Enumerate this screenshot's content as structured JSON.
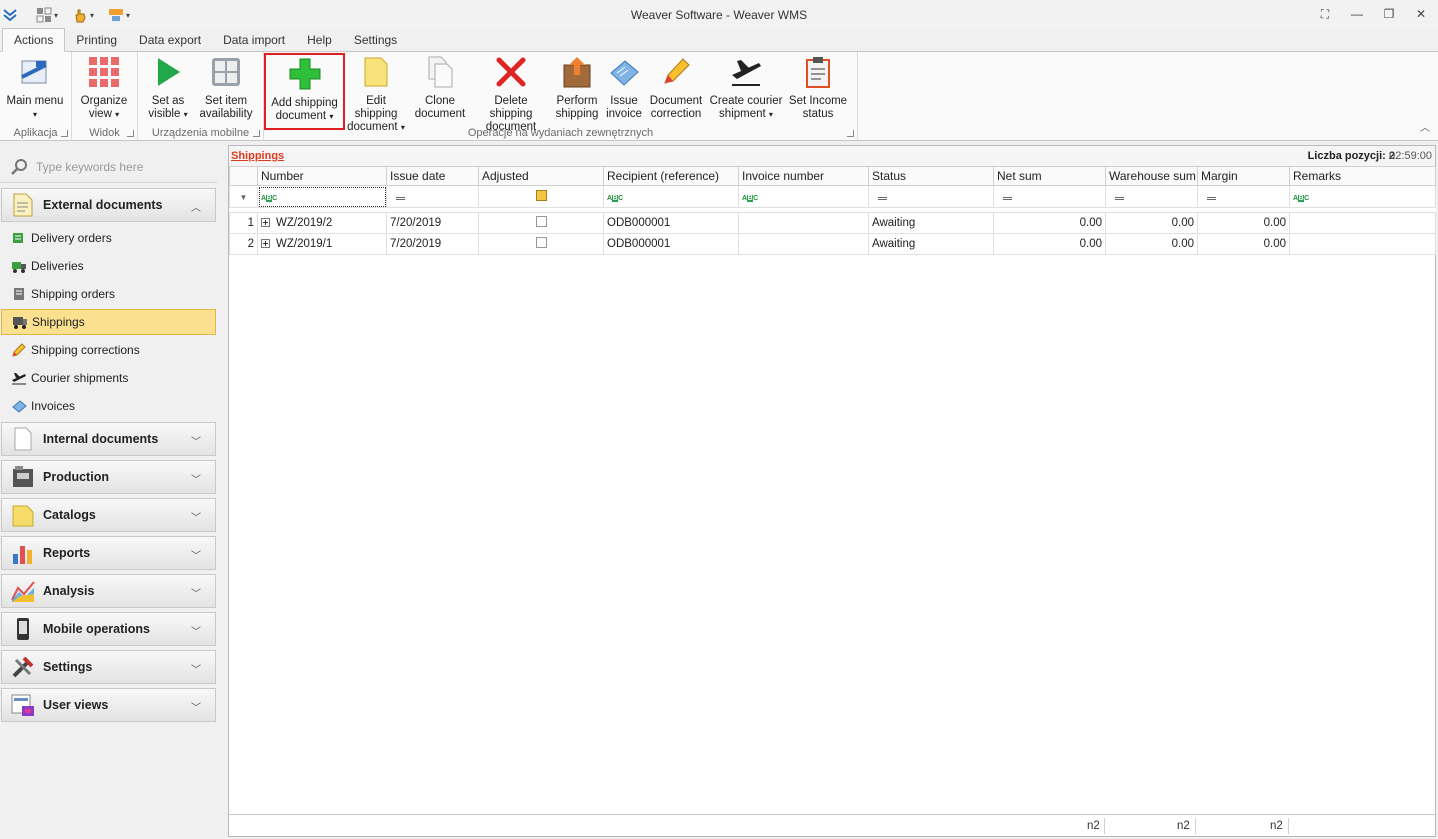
{
  "window": {
    "title": "Weaver Software - Weaver WMS"
  },
  "tabs": [
    {
      "label": "Actions",
      "active": true
    },
    {
      "label": "Printing"
    },
    {
      "label": "Data export"
    },
    {
      "label": "Data import"
    },
    {
      "label": "Help"
    },
    {
      "label": "Settings"
    }
  ],
  "ribbon": {
    "groups": {
      "aplikacja": "Aplikacja",
      "widok": "Widok",
      "urzadzenia": "Urządzenia mobilne",
      "operacje": "Operacje na wydaniach zewnętrznych"
    },
    "buttons": {
      "main_menu": {
        "l1": "Main menu",
        "l2": ""
      },
      "organize_view": {
        "l1": "Organize",
        "l2": "view"
      },
      "set_visible": {
        "l1": "Set as",
        "l2": "visible"
      },
      "set_availability": {
        "l1": "Set item",
        "l2": "availability"
      },
      "add_shipping": {
        "l1": "Add shipping",
        "l2": "document"
      },
      "edit_shipping": {
        "l1": "Edit shipping",
        "l2": "document"
      },
      "clone": {
        "l1": "Clone",
        "l2": "document"
      },
      "delete_shipping": {
        "l1": "Delete shipping",
        "l2": "document"
      },
      "perform_shipping": {
        "l1": "Perform",
        "l2": "shipping"
      },
      "issue_invoice": {
        "l1": "Issue",
        "l2": "invoice"
      },
      "document_correction": {
        "l1": "Document",
        "l2": "correction"
      },
      "courier_shipment": {
        "l1": "Create courier",
        "l2": "shipment"
      },
      "income_status": {
        "l1": "Set Income",
        "l2": "status"
      }
    }
  },
  "sidebar": {
    "search_placeholder": "Type keywords here",
    "groups": [
      {
        "label": "External documents",
        "expanded": true
      },
      {
        "label": "Internal documents"
      },
      {
        "label": "Production"
      },
      {
        "label": "Catalogs"
      },
      {
        "label": "Reports"
      },
      {
        "label": "Analysis"
      },
      {
        "label": "Mobile operations"
      },
      {
        "label": "Settings"
      },
      {
        "label": "User views"
      }
    ],
    "items": [
      {
        "label": "Delivery orders"
      },
      {
        "label": "Deliveries"
      },
      {
        "label": "Shipping orders"
      },
      {
        "label": "Shippings",
        "selected": true
      },
      {
        "label": "Shipping corrections"
      },
      {
        "label": "Courier shipments"
      },
      {
        "label": "Invoices"
      }
    ]
  },
  "grid": {
    "title": "Shippings",
    "count_label": "Liczba pozycji: 2",
    "time": "02:59:00",
    "columns": [
      "Number",
      "Issue date",
      "Adjusted",
      "Recipient (reference)",
      "Invoice number",
      "Status",
      "Net sum",
      "Warehouse sum",
      "Margin",
      "Remarks"
    ],
    "rows": [
      {
        "rn": "1",
        "number": "WZ/2019/2",
        "date": "7/20/2019",
        "adjusted": false,
        "recipient": "ODB000001",
        "invoice": "",
        "status": "Awaiting",
        "net": "0.00",
        "wh": "0.00",
        "margin": "0.00",
        "remarks": ""
      },
      {
        "rn": "2",
        "number": "WZ/2019/1",
        "date": "7/20/2019",
        "adjusted": false,
        "recipient": "ODB000001",
        "invoice": "",
        "status": "Awaiting",
        "net": "0.00",
        "wh": "0.00",
        "margin": "0.00",
        "remarks": ""
      }
    ],
    "footer": {
      "net": "n2",
      "wh": "n2",
      "margin": "n2"
    }
  },
  "colors": {
    "selected_item": "#fbe090",
    "highlight_border": "#e02020",
    "title_link": "#e03a1e"
  }
}
